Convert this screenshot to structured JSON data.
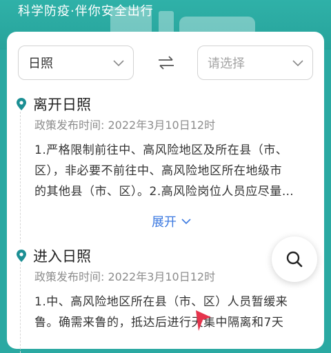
{
  "header": {
    "slogan": "科学防疫·伴你安全出行"
  },
  "route": {
    "from_value": "日照",
    "to_placeholder": "请选择",
    "swap_icon": "swap-arrows-icon"
  },
  "sections": [
    {
      "title": "离开日照",
      "date": "政策发布时间: 2022年3月10日12时",
      "lines": [
        "1.严格限制前往中、高风险地区及所在县（市、",
        "区），非必要不前往中、高风险地区所在地级市",
        "的其他县（市、区）。2.高风险岗位人员应尽量…"
      ],
      "expand_label": "展开"
    },
    {
      "title": "进入日照",
      "date": "政策发布时间: 2022年3月10日12时",
      "lines": [
        "1.中、高风险地区所在县（市、区）人员暂缓来",
        "鲁。确需来鲁的，抵达后进行天集中隔离和7天"
      ]
    }
  ],
  "colors": {
    "teal": "#2aa9a2",
    "pin": "#1c8f94",
    "link": "#3a78e0"
  }
}
